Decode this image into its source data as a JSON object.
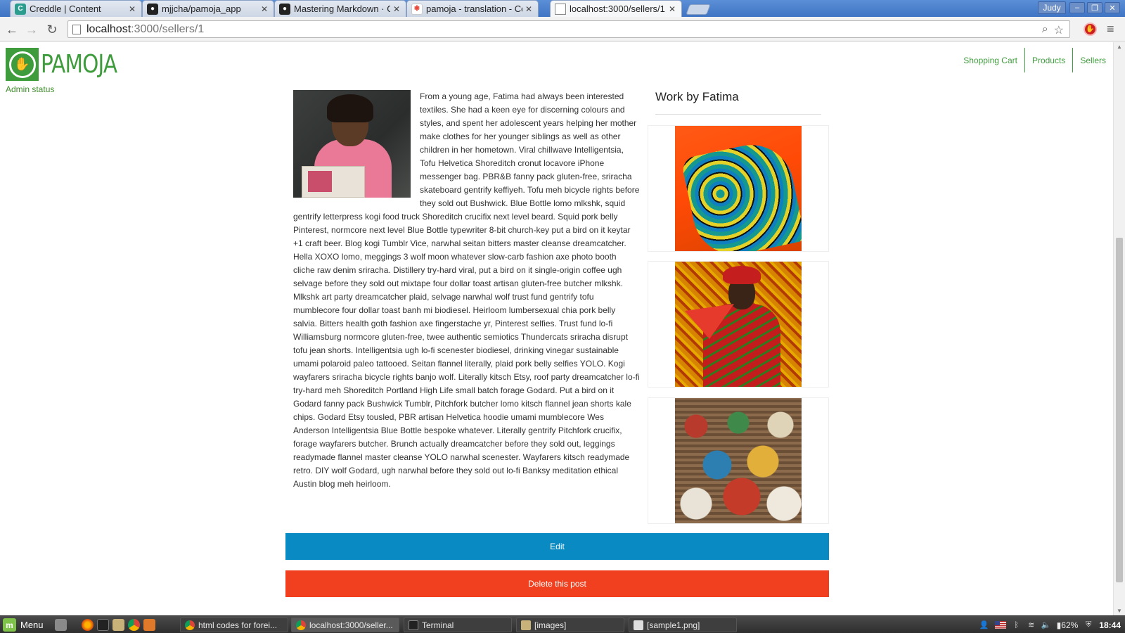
{
  "browser": {
    "tabs": [
      {
        "title": "Creddle | Content",
        "favicon": "creddle-icon",
        "fav_color": "#2a9d8f",
        "fav_char": "C"
      },
      {
        "title": "mjjcha/pamoja_app",
        "favicon": "github-icon",
        "fav_color": "#222222",
        "fav_char": "●"
      },
      {
        "title": "Mastering Markdown · G",
        "favicon": "github-icon",
        "fav_color": "#222222",
        "fav_char": "●"
      },
      {
        "title": "pamoja - translation - Co",
        "favicon": "google-photos-icon",
        "fav_color": "#e84b3c",
        "fav_char": "✱"
      },
      {
        "title": "localhost:3000/sellers/1",
        "favicon": "page-icon",
        "fav_color": "#ffffff",
        "fav_char": ""
      }
    ],
    "active_tab": 4,
    "user": "Judy",
    "url_host": "localhost",
    "url_path": ":3000/sellers/1"
  },
  "site": {
    "brand": "PAMOJA",
    "brand_color": "#3f9c3d",
    "admin_link": "Admin status",
    "nav": [
      "Shopping Cart",
      "Products",
      "Sellers"
    ]
  },
  "seller": {
    "bio": "From a young age, Fatima had always been interested textiles. She had a keen eye for discerning colours and styles, and spent her adolescent years helping her mother make clothes for her younger siblings as well as other children in her hometown. Viral chillwave Intelligentsia, Tofu Helvetica Shoreditch cronut locavore iPhone messenger bag. PBR&B fanny pack gluten-free, sriracha skateboard gentrify keffiyeh. Tofu meh bicycle rights before they sold out Bushwick. Blue Bottle lomo mlkshk, squid gentrify letterpress kogi food truck Shoreditch crucifix next level beard. Squid pork belly Pinterest, normcore next level Blue Bottle typewriter 8-bit church-key put a bird on it keytar +1 craft beer. Blog kogi Tumblr Vice, narwhal seitan bitters master cleanse dreamcatcher. Hella XOXO lomo, meggings 3 wolf moon whatever slow-carb fashion axe photo booth cliche raw denim sriracha. Distillery try-hard viral, put a bird on it single-origin coffee ugh selvage before they sold out mixtape four dollar toast artisan gluten-free butcher mlkshk. Mlkshk art party dreamcatcher plaid, selvage narwhal wolf trust fund gentrify tofu mumblecore four dollar toast banh mi biodiesel. Heirloom lumbersexual chia pork belly salvia. Bitters health goth fashion axe fingerstache yr, Pinterest selfies. Trust fund lo-fi Williamsburg normcore gluten-free, twee authentic semiotics Thundercats sriracha disrupt tofu jean shorts. Intelligentsia ugh lo-fi scenester biodiesel, drinking vinegar sustainable umami polaroid paleo tattooed. Seitan flannel literally, plaid pork belly selfies YOLO. Kogi wayfarers sriracha bicycle rights banjo wolf. Literally kitsch Etsy, roof party dreamcatcher lo-fi try-hard meh Shoreditch Portland High Life small batch forage Godard. Put a bird on it Godard fanny pack Bushwick Tumblr, Pitchfork butcher lomo kitsch flannel jean shorts kale chips. Godard Etsy tousled, PBR artisan Helvetica hoodie umami mumblecore Wes Anderson Intelligentsia Blue Bottle bespoke whatever. Literally gentrify Pitchfork crucifix, forage wayfarers butcher. Brunch actually dreamcatcher before they sold out, leggings readymade flannel master cleanse YOLO narwhal scenester. Wayfarers kitsch readymade retro. DIY wolf Godard, ugh narwhal before they sold out lo-fi Banksy meditation ethical Austin blog meh heirloom.",
    "work_title": "Work by Fatima"
  },
  "actions": {
    "edit": "Edit",
    "delete": "Delete this post",
    "edit_color": "#0a8ac3",
    "delete_color": "#f0401f"
  },
  "taskbar": {
    "menu": "Menu",
    "tasks": [
      "html codes for forei...",
      "localhost:3000/seller...",
      "Terminal",
      "[images]",
      "[sample1.png]"
    ],
    "battery": "62%",
    "clock": "18:44"
  }
}
